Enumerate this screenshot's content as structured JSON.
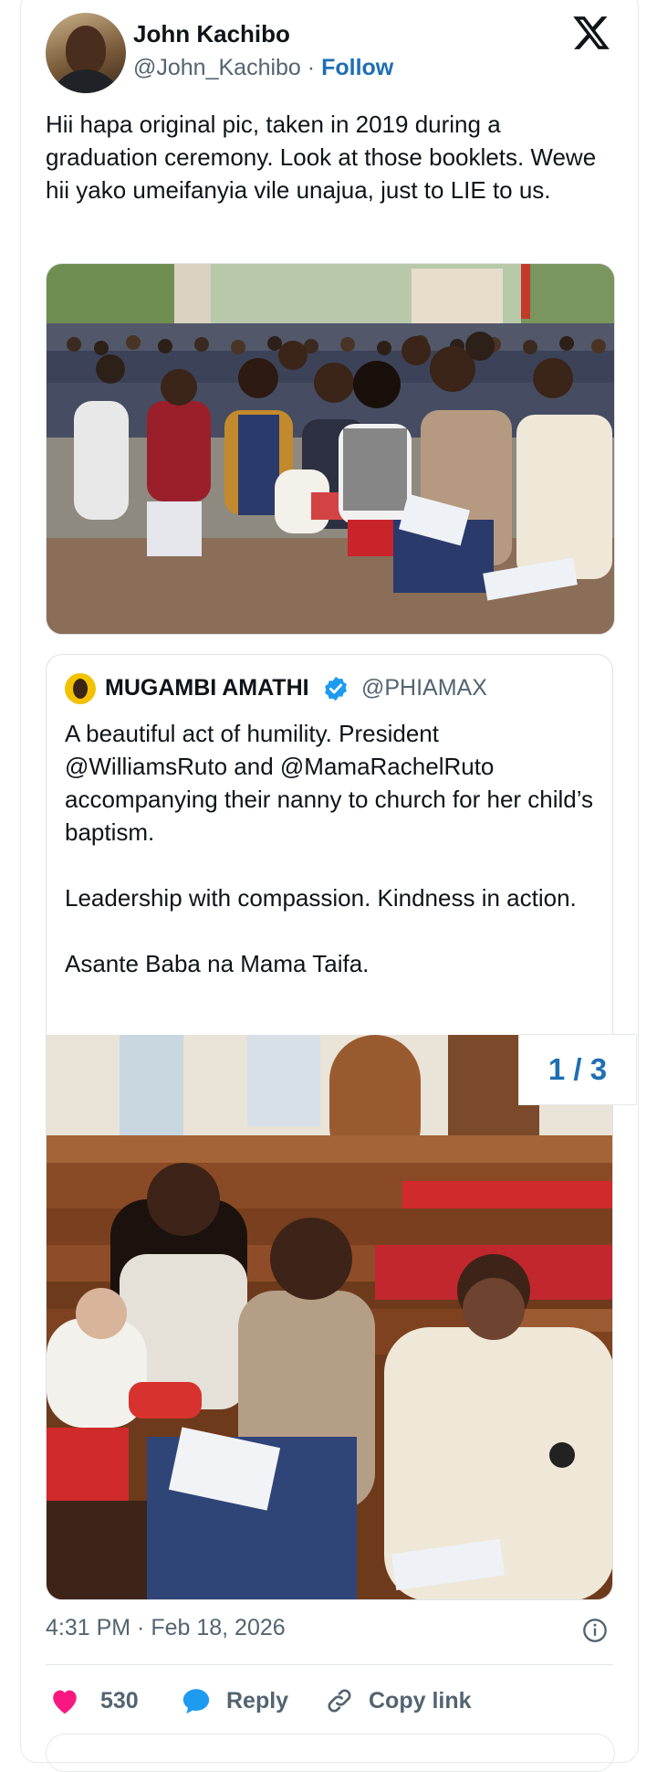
{
  "author": {
    "name": "John Kachibo",
    "handle": "@John_Kachibo",
    "separator": "·",
    "follow_label": "Follow"
  },
  "tweet": {
    "text": "Hii hapa original pic, taken in 2019 during a graduation ceremony. Look at those booklets. Wewe hii yako umeifanyia vile unajua, just to LIE to us."
  },
  "quoted": {
    "name": "MUGAMBI AMATHI",
    "handle": "@PHIAMAX",
    "paragraphs": [
      "A beautiful act of humility. President @WilliamsRuto and @MamaRachelRuto accompanying their nanny to church for her child’s baptism.",
      "Leadership with compassion. Kindness in action.",
      "Asante Baba na Mama Taifa."
    ],
    "pager": "1 / 3"
  },
  "meta": {
    "timestamp": "4:31 PM · Feb 18, 2026"
  },
  "actions": {
    "likes": "530",
    "reply_label": "Reply",
    "copy_label": "Copy link"
  },
  "colors": {
    "accent": "#1d6fb3",
    "like": "#f91880",
    "reply": "#1d9bf0",
    "muted": "#536471"
  },
  "icons": [
    "x-logo-icon",
    "verified-badge-icon",
    "info-icon",
    "heart-icon",
    "reply-bubble-icon",
    "link-icon"
  ]
}
